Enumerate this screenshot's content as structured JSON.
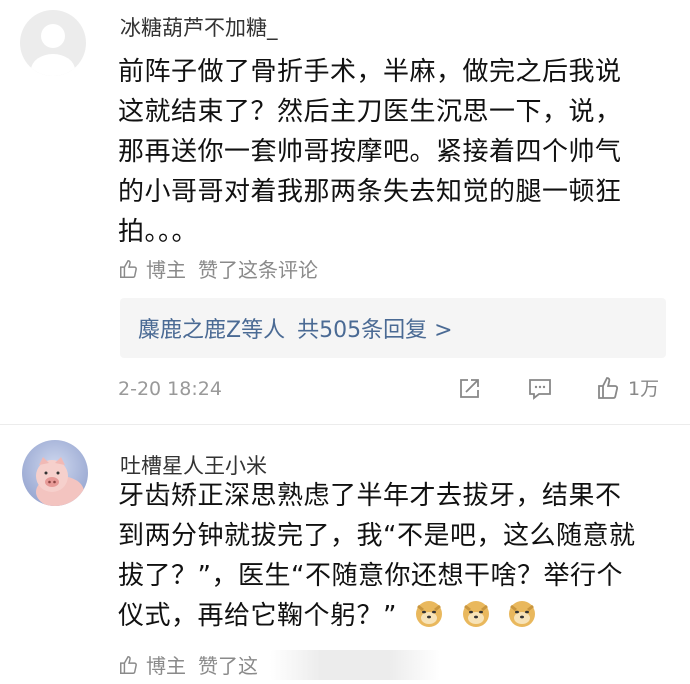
{
  "comments": [
    {
      "username": "冰糖葫芦不加糖_",
      "lines": [
        "前阵子做了骨折手术，半麻，做完之后我说",
        "这就结束了？然后主刀医生沉思一下，说，",
        "那再送你一套帅哥按摩吧。紧接着四个帅气",
        "的小哥哥对着我那两条失去知觉的腿一顿狂",
        "拍。。。"
      ],
      "liked_by": "博主",
      "liked_text": "赞了这条评论",
      "reply_names": "麋鹿之鹿Z等人",
      "reply_count": "共505条回复 >",
      "timestamp": "2-20 18:24",
      "like_count": "1万"
    },
    {
      "username": "吐槽星人王小米",
      "lines": [
        "牙齿矫正深思熟虑了半年才去拔牙，结果不",
        "到两分钟就拔完了，我“不是吧，这么随意就",
        "拔了？”，医生“不随意你还想干啥？举行个",
        "仪式，再给它鞠个躬？”"
      ],
      "liked_by": "博主",
      "liked_text": "赞了这",
      "emoji": [
        "doge-emoji",
        "doge-emoji",
        "doge-emoji"
      ]
    }
  ],
  "colors": {
    "link": "#4a6a94",
    "meta": "#999999",
    "reply_bg": "#f5f5f5"
  },
  "icons": [
    "thumb-up-icon",
    "share-icon",
    "comment-icon",
    "like-icon"
  ]
}
